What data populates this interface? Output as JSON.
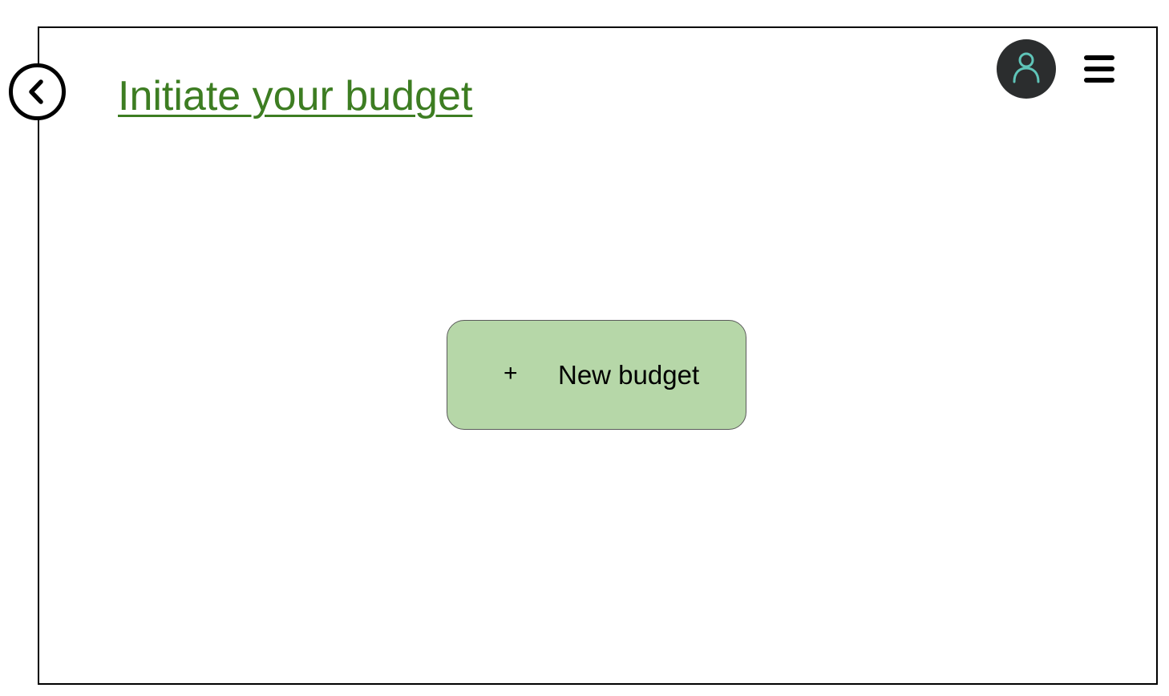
{
  "header": {
    "title": "Initiate your budget",
    "back_icon": "chevron-left-circle-icon",
    "avatar_icon": "user-icon",
    "menu_icon": "hamburger-menu-icon"
  },
  "main": {
    "new_budget_button": {
      "icon": "plus-icon",
      "icon_glyph": "+",
      "label": "New budget"
    }
  },
  "colors": {
    "title": "#3d7d22",
    "button_fill": "#b6d7a8",
    "avatar_bg": "#2b2d2e",
    "avatar_figure": "#5fc4b8"
  }
}
